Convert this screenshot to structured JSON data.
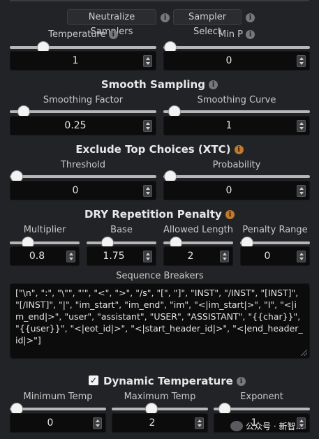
{
  "toolbar": {
    "neutralize_label": "Neutralize Samplers",
    "sampler_select_label": "Sampler Select"
  },
  "basic": {
    "temperature": {
      "label": "Temperature",
      "value": "1",
      "slider_fraction": 0.2
    },
    "min_p": {
      "label": "Min P",
      "value": "0",
      "slider_fraction": 0.0
    }
  },
  "smooth_sampling": {
    "title": "Smooth Sampling",
    "smoothing_factor": {
      "label": "Smoothing Factor",
      "value": "0.25",
      "slider_fraction": 0.05
    },
    "smoothing_curve": {
      "label": "Smoothing Curve",
      "value": "1",
      "slider_fraction": 0.03
    }
  },
  "xtc": {
    "title": "Exclude Top Choices (XTC)",
    "threshold": {
      "label": "Threshold",
      "value": "0",
      "slider_fraction": 0.0
    },
    "probability": {
      "label": "Probability",
      "value": "0",
      "slider_fraction": 0.0
    }
  },
  "dry": {
    "title": "DRY Repetition Penalty",
    "multiplier": {
      "label": "Multiplier",
      "value": "0.8",
      "slider_fraction": 0.2
    },
    "base": {
      "label": "Base",
      "value": "1.75",
      "slider_fraction": 0.25
    },
    "allowed_length": {
      "label": "Allowed Length",
      "value": "2",
      "slider_fraction": 0.1
    },
    "penalty_range": {
      "label": "Penalty Range",
      "value": "0",
      "slider_fraction": 0.0
    },
    "sequence_breakers_label": "Sequence Breakers",
    "sequence_breakers_value": "[\"\\n\", \":\", \"\\\"\", \"'\", \"<\", \">\", \"/s\", \"[\", \"]\", \"INST\", \"/INST\", \"[INST]\", \"[/INST]\", \"|\", \"im_start\", \"im_end\", \"im\", \"<|im_start|>\",  \"I\", \"<|im_end|>\", \"user\", \"assistant\", \"USER\", \"ASSISTANT\", \"{{char}}\", \"{{user}}\", \"<|eot_id|>\", \"<|start_header_id|>\", \"<|end_header_id|>\"]"
  },
  "dynamic_temperature": {
    "title": "Dynamic Temperature",
    "enabled": true,
    "minimum_temp": {
      "label": "Minimum Temp",
      "value": "0",
      "slider_fraction": 0.0
    },
    "maximum_temp": {
      "label": "Maximum Temp",
      "value": "2",
      "slider_fraction": 0.4
    },
    "exponent": {
      "label": "Exponent",
      "value": "1",
      "slider_fraction": 0.05
    }
  },
  "watermark_text": "公众号 · 新智..."
}
